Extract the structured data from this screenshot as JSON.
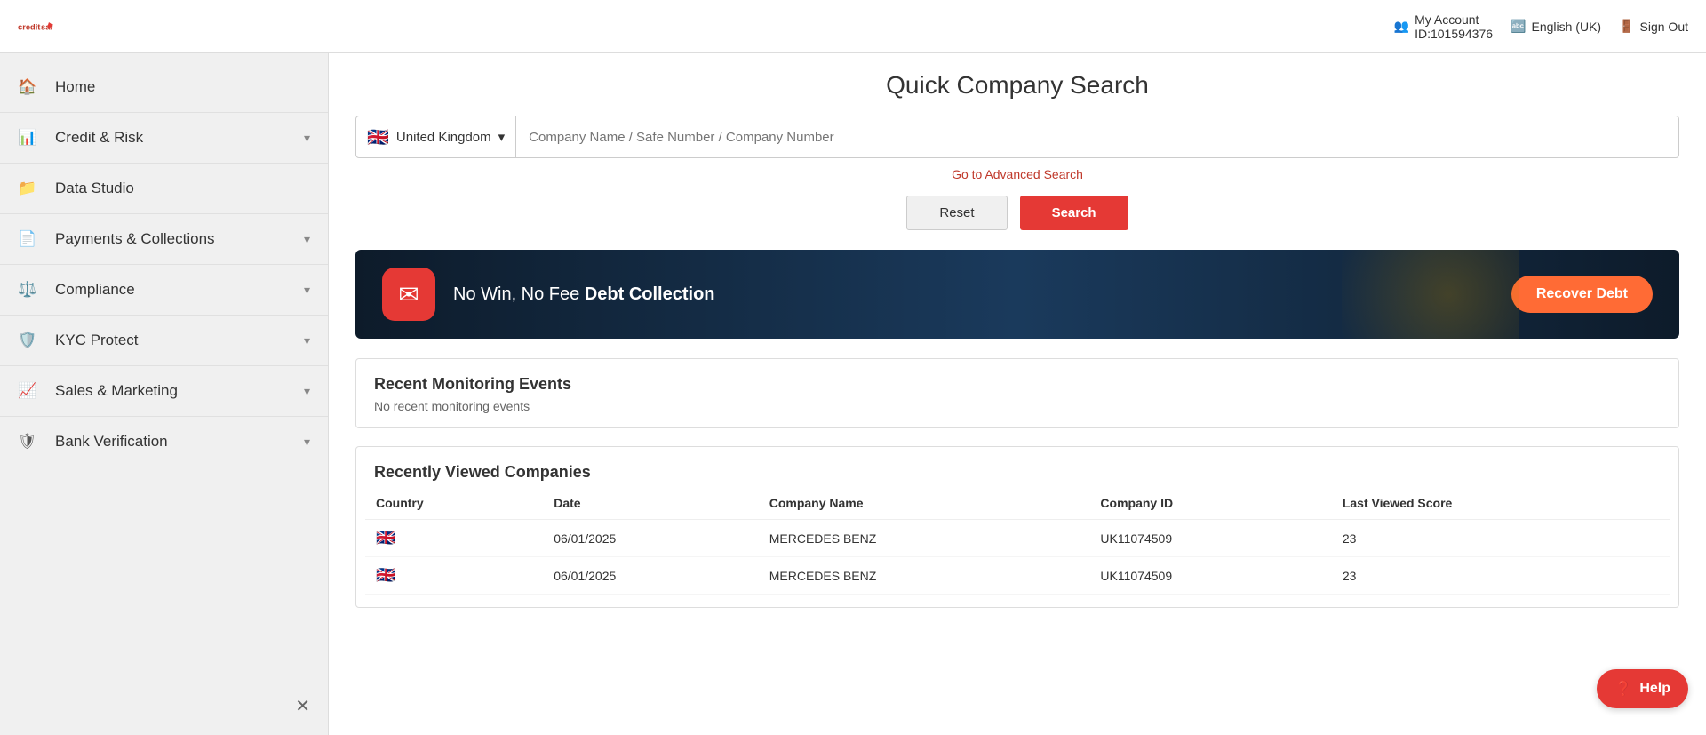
{
  "topbar": {
    "logo": "creditsafe",
    "account_label": "My Account",
    "account_id": "ID:101594376",
    "language_label": "English (UK)",
    "signout_label": "Sign Out"
  },
  "sidebar": {
    "items": [
      {
        "id": "home",
        "label": "Home",
        "icon": "home-icon",
        "has_chevron": false
      },
      {
        "id": "credit-risk",
        "label": "Credit & Risk",
        "icon": "credit-icon",
        "has_chevron": true
      },
      {
        "id": "data-studio",
        "label": "Data Studio",
        "icon": "data-icon",
        "has_chevron": false
      },
      {
        "id": "payments-collections",
        "label": "Payments & Collections",
        "icon": "payments-icon",
        "has_chevron": true
      },
      {
        "id": "compliance",
        "label": "Compliance",
        "icon": "compliance-icon",
        "has_chevron": true
      },
      {
        "id": "kyc-protect",
        "label": "KYC Protect",
        "icon": "kyc-icon",
        "has_chevron": true
      },
      {
        "id": "sales-marketing",
        "label": "Sales & Marketing",
        "icon": "sales-icon",
        "has_chevron": true
      },
      {
        "id": "bank-verification",
        "label": "Bank Verification",
        "icon": "bank-icon",
        "has_chevron": true
      }
    ]
  },
  "search": {
    "page_title": "Quick Company Search",
    "country": "United Kingdom",
    "placeholder": "Company Name / Safe Number / Company Number",
    "advanced_link": "Go to Advanced Search",
    "reset_label": "Reset",
    "search_label": "Search"
  },
  "banner": {
    "text_part1": "No Win, No Fee ",
    "text_bold": "Debt Collection",
    "btn_label": "Recover Debt"
  },
  "monitoring": {
    "title": "Recent Monitoring Events",
    "empty_text": "No recent monitoring events"
  },
  "recently_viewed": {
    "title": "Recently Viewed Companies",
    "columns": [
      "Country",
      "Date",
      "Company Name",
      "Company ID",
      "Last Viewed Score"
    ],
    "rows": [
      {
        "country_flag": "🇬🇧",
        "date": "06/01/2025",
        "company_name": "MERCEDES BENZ",
        "company_id": "UK11074509",
        "score": "23"
      },
      {
        "country_flag": "🇬🇧",
        "date": "06/01/2025",
        "company_name": "MERCEDES BENZ",
        "company_id": "UK11074509",
        "score": "23"
      }
    ]
  },
  "help": {
    "label": "Help"
  }
}
